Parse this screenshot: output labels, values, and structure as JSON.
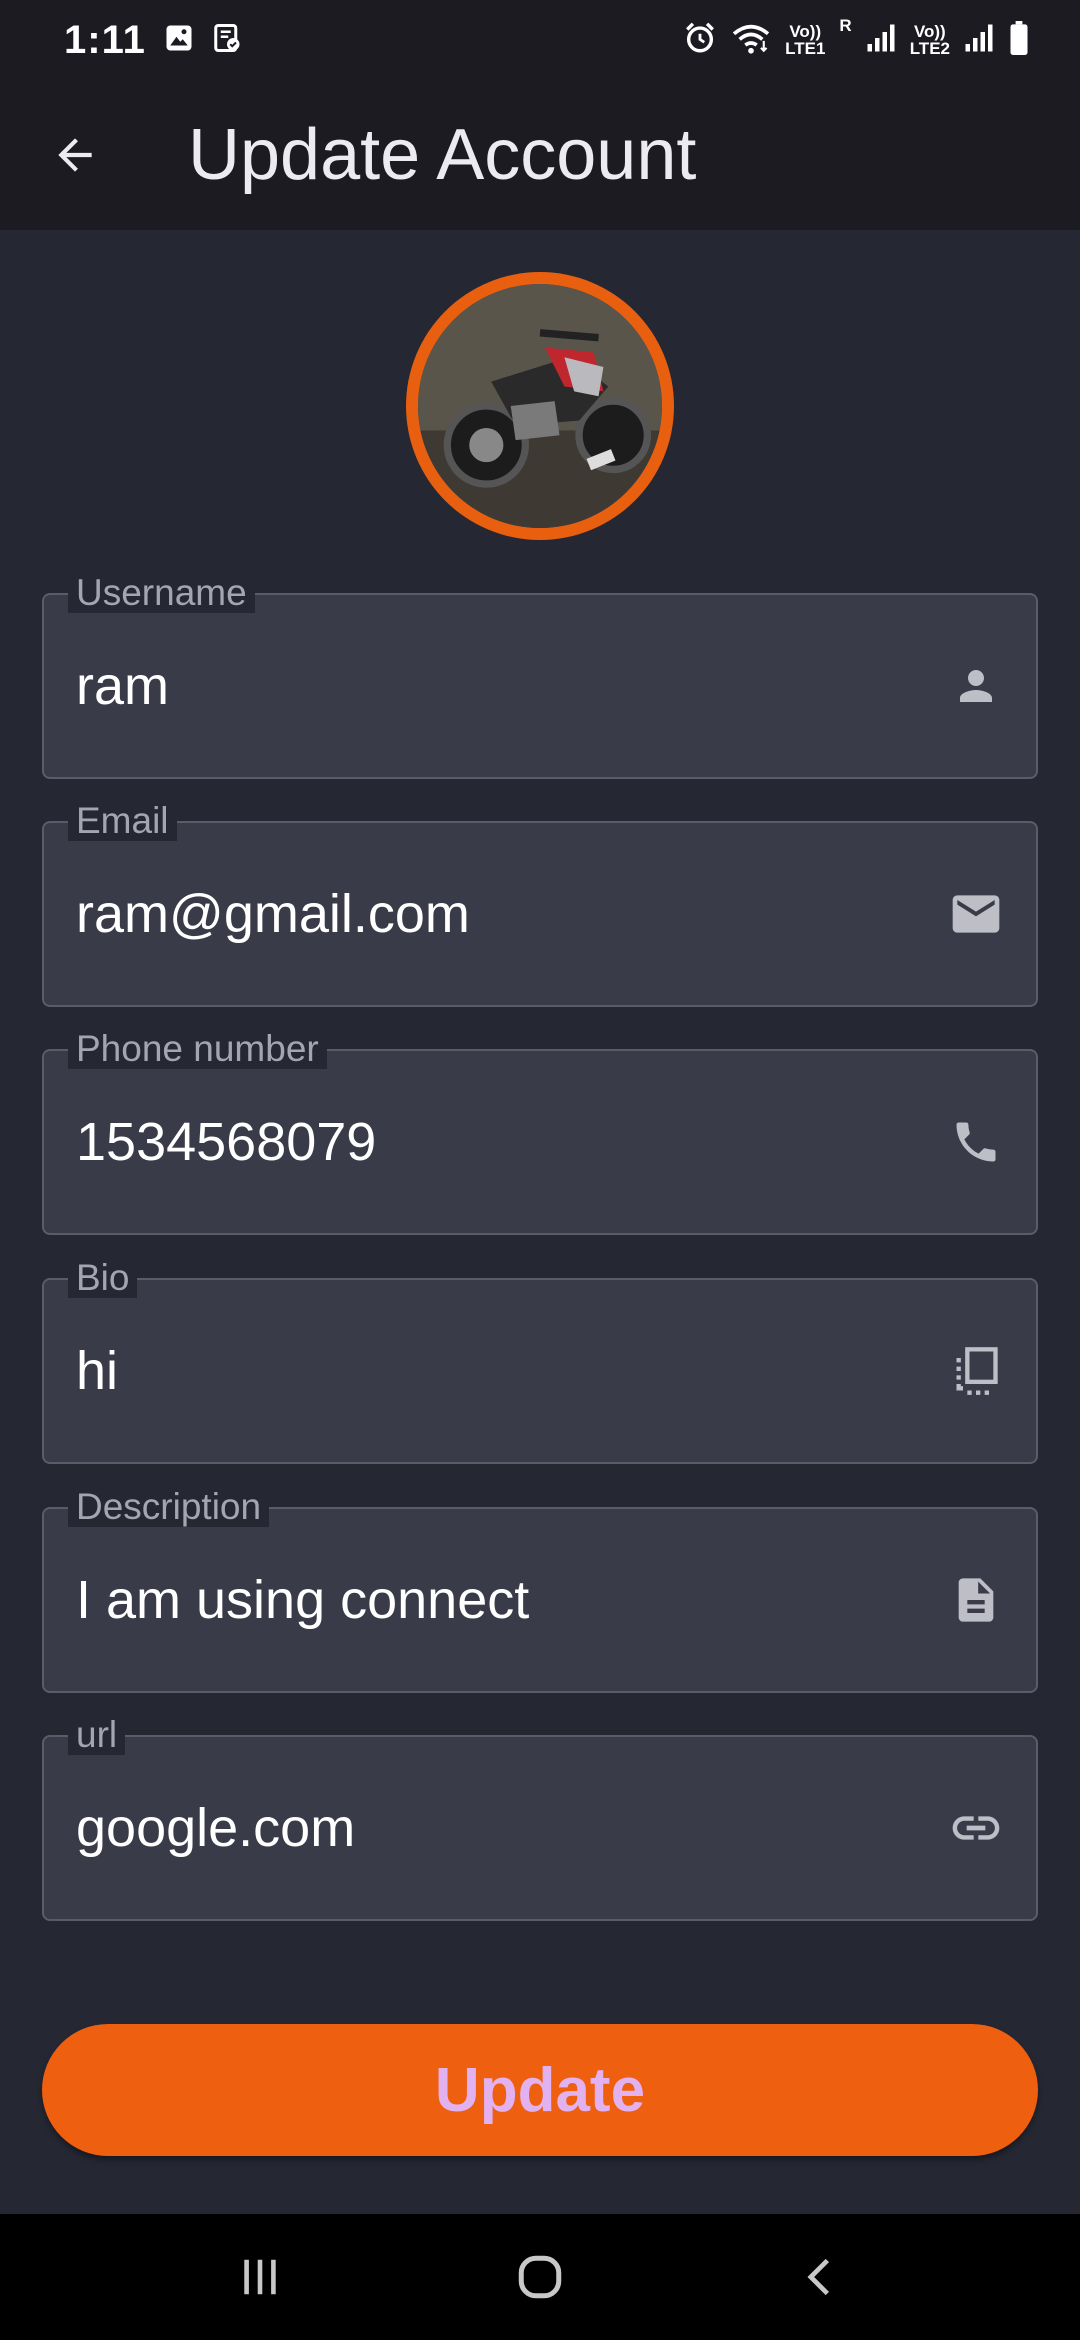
{
  "status_bar": {
    "time": "1:11",
    "sim1_top": "Vo))",
    "sim1_bottom": "LTE1",
    "roaming": "R",
    "sim2_top": "Vo))",
    "sim2_bottom": "LTE2"
  },
  "app_bar": {
    "title": "Update Account"
  },
  "form": {
    "fields": [
      {
        "label": "Username",
        "value": "ram",
        "icon": "person-icon"
      },
      {
        "label": "Email",
        "value": "ram@gmail.com",
        "icon": "mail-icon"
      },
      {
        "label": "Phone number",
        "value": "1534568079",
        "icon": "phone-icon"
      },
      {
        "label": "Bio",
        "value": "hi",
        "icon": "bio-icon"
      },
      {
        "label": "Description",
        "value": "I am using connect",
        "icon": "description-icon"
      },
      {
        "label": "url",
        "value": "google.com",
        "icon": "link-icon"
      }
    ],
    "submit_label": "Update"
  },
  "colors": {
    "accent": "#ee5f10",
    "button_text": "#e1b1f0",
    "background": "#252733",
    "field_bg": "#3a3b48"
  }
}
